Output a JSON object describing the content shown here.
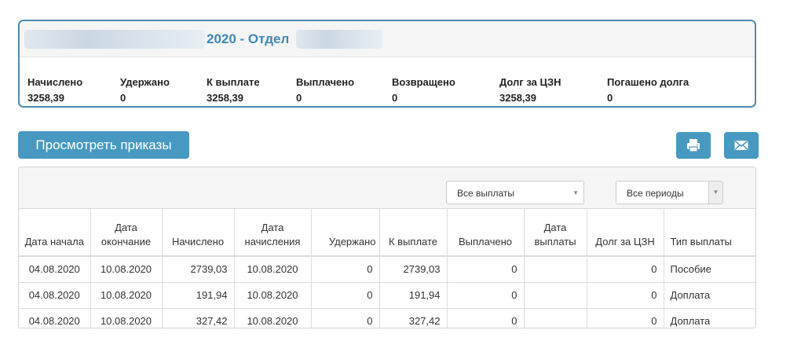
{
  "summary": {
    "title": "2020 - Отдел",
    "stats": [
      {
        "label": "Начислено",
        "value": "3258,39"
      },
      {
        "label": "Удержано",
        "value": "0"
      },
      {
        "label": "К выплате",
        "value": "3258,39"
      },
      {
        "label": "Выплачено",
        "value": "0"
      },
      {
        "label": "Возвращено",
        "value": "0"
      },
      {
        "label": "Долг за ЦЗН",
        "value": "3258,39"
      },
      {
        "label": "Погашено долга",
        "value": "0"
      }
    ]
  },
  "toolbar": {
    "view_orders_label": "Просмотреть приказы",
    "print_icon": "printer-icon",
    "email_icon": "envelope-icon",
    "accent_color": "#4799c1"
  },
  "filters": {
    "payments_selected": "Все выплаты",
    "periods_selected": "Все периоды"
  },
  "table": {
    "headers": [
      "Дата начала",
      "Дата окончание",
      "Начислено",
      "Дата начисления",
      "Удержано",
      "К выплате",
      "Выплачено",
      "Дата выплаты",
      "Долг за ЦЗН",
      "Тип выплаты"
    ],
    "rows": [
      [
        "04.08.2020",
        "10.08.2020",
        "2739,03",
        "10.08.2020",
        "0",
        "2739,03",
        "0",
        "",
        "0",
        "Пособие"
      ],
      [
        "04.08.2020",
        "10.08.2020",
        "191,94",
        "10.08.2020",
        "0",
        "191,94",
        "0",
        "",
        "0",
        "Доплата"
      ],
      [
        "04.08.2020",
        "10.08.2020",
        "327,42",
        "10.08.2020",
        "0",
        "327,42",
        "0",
        "",
        "0",
        "Доплата"
      ]
    ]
  }
}
